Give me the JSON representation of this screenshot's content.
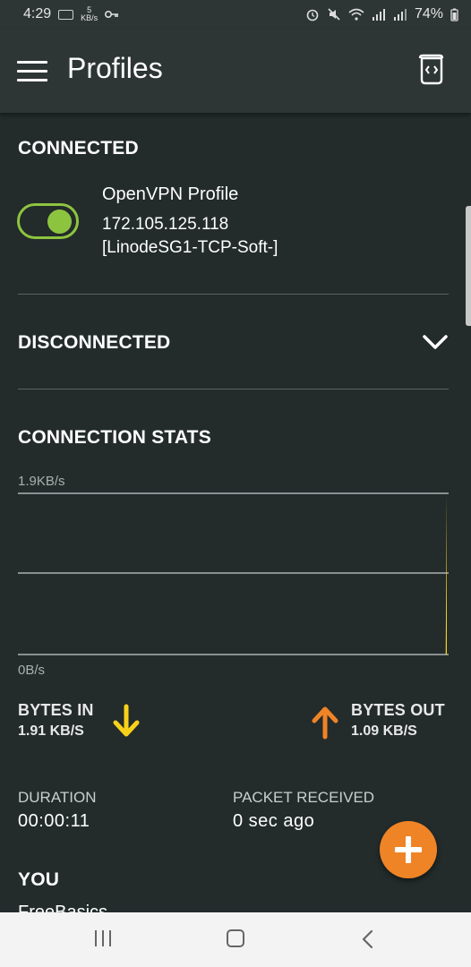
{
  "status": {
    "time": "4:29",
    "speed_num": "5",
    "speed_unit": "KB/s",
    "battery": "74%"
  },
  "appbar": {
    "title": "Profiles"
  },
  "connected": {
    "title": "CONNECTED",
    "profile_name": "OpenVPN Profile",
    "profile_ip": "172.105.125.118",
    "profile_server": "[LinodeSG1-TCP-Soft-]",
    "toggle_on": true
  },
  "disconnected": {
    "title": "DISCONNECTED"
  },
  "stats": {
    "title": "CONNECTION STATS",
    "bytes_in_label": "BYTES IN",
    "bytes_in_value": "1.91 KB/S",
    "bytes_out_label": "BYTES OUT",
    "bytes_out_value": "1.09 KB/S",
    "duration_label": "DURATION",
    "duration_value": "00:00:11",
    "packet_label": "PACKET RECEIVED",
    "packet_value": "0 sec ago"
  },
  "chart_data": {
    "type": "area",
    "ylim": [
      0,
      1.9
    ],
    "y_top_label": "1.9KB/s",
    "y_bottom_label": "0B/s",
    "series": [
      {
        "color": "#f7d21a",
        "values": [
          0,
          0,
          0,
          0,
          0,
          0,
          0,
          0,
          0,
          0,
          1.9
        ]
      }
    ]
  },
  "you": {
    "title": "YOU",
    "partial_text": "FreeBasics"
  },
  "colors": {
    "accent_green": "#8dc43f",
    "accent_orange": "#ef8427",
    "accent_yellow": "#f7d21a",
    "background": "#232b2b"
  }
}
